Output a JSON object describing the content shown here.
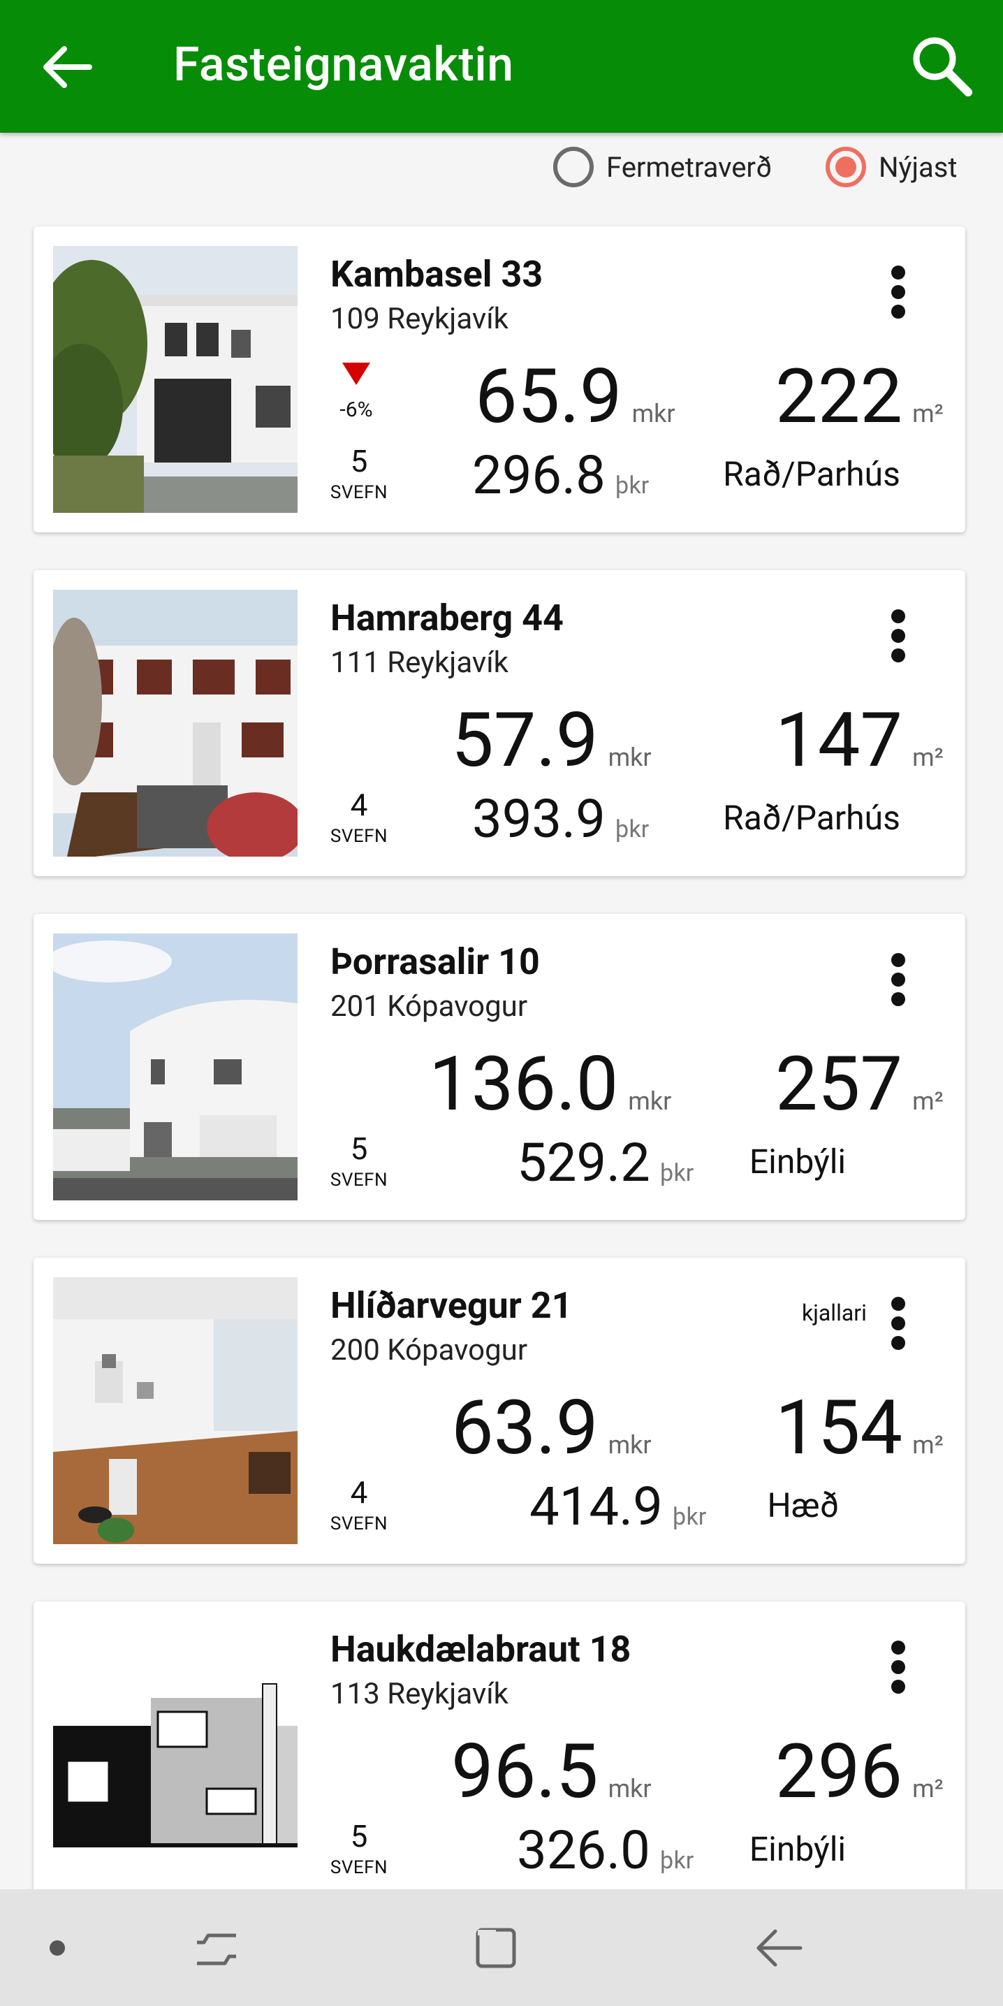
{
  "appbar": {
    "title": "Fasteignavaktin",
    "back_icon": "arrow-left-icon",
    "search_icon": "magnifier-icon",
    "color": "#078c07"
  },
  "sort": {
    "options": [
      {
        "label": "Fermetraverð",
        "selected": false
      },
      {
        "label": "Nýjast",
        "selected": true
      }
    ],
    "accent": "#ef6f5f"
  },
  "listings": [
    {
      "street": "Kambasel 33",
      "postal": "109 Reykjavík",
      "trend": "-6%",
      "price": "65.9",
      "price_unit": "mkr",
      "ppm": "296.8",
      "ppm_unit": "þkr",
      "size": "222",
      "size_unit": "m²",
      "type": "Rað/Parhús",
      "bedrooms": "5",
      "bedrooms_label": "SVEFN"
    },
    {
      "street": "Hamraberg 44",
      "postal": "111 Reykjavík",
      "price": "57.9",
      "price_unit": "mkr",
      "ppm": "393.9",
      "ppm_unit": "þkr",
      "size": "147",
      "size_unit": "m²",
      "type": "Rað/Parhús",
      "bedrooms": "4",
      "bedrooms_label": "SVEFN"
    },
    {
      "street": "Þorrasalir 10",
      "postal": "201 Kópavogur",
      "price": "136.0",
      "price_unit": "mkr",
      "ppm": "529.2",
      "ppm_unit": "þkr",
      "size": "257",
      "size_unit": "m²",
      "type": "Einbýli",
      "bedrooms": "5",
      "bedrooms_label": "SVEFN"
    },
    {
      "street": "Hlíðarvegur 21",
      "postal": "200 Kópavogur",
      "tag": "kjallari",
      "price": "63.9",
      "price_unit": "mkr",
      "ppm": "414.9",
      "ppm_unit": "þkr",
      "size": "154",
      "size_unit": "m²",
      "type": "Hæð",
      "bedrooms": "4",
      "bedrooms_label": "SVEFN"
    },
    {
      "street": "Haukdælabraut 18",
      "postal": "113 Reykjavík",
      "price": "96.5",
      "price_unit": "mkr",
      "ppm": "326.0",
      "ppm_unit": "þkr",
      "size": "296",
      "size_unit": "m²",
      "type": "Einbýli",
      "bedrooms": "5",
      "bedrooms_label": "SVEFN"
    }
  ],
  "navbar": {
    "icons": [
      "dot-icon",
      "recents-icon",
      "home-square-icon",
      "back-icon"
    ]
  }
}
